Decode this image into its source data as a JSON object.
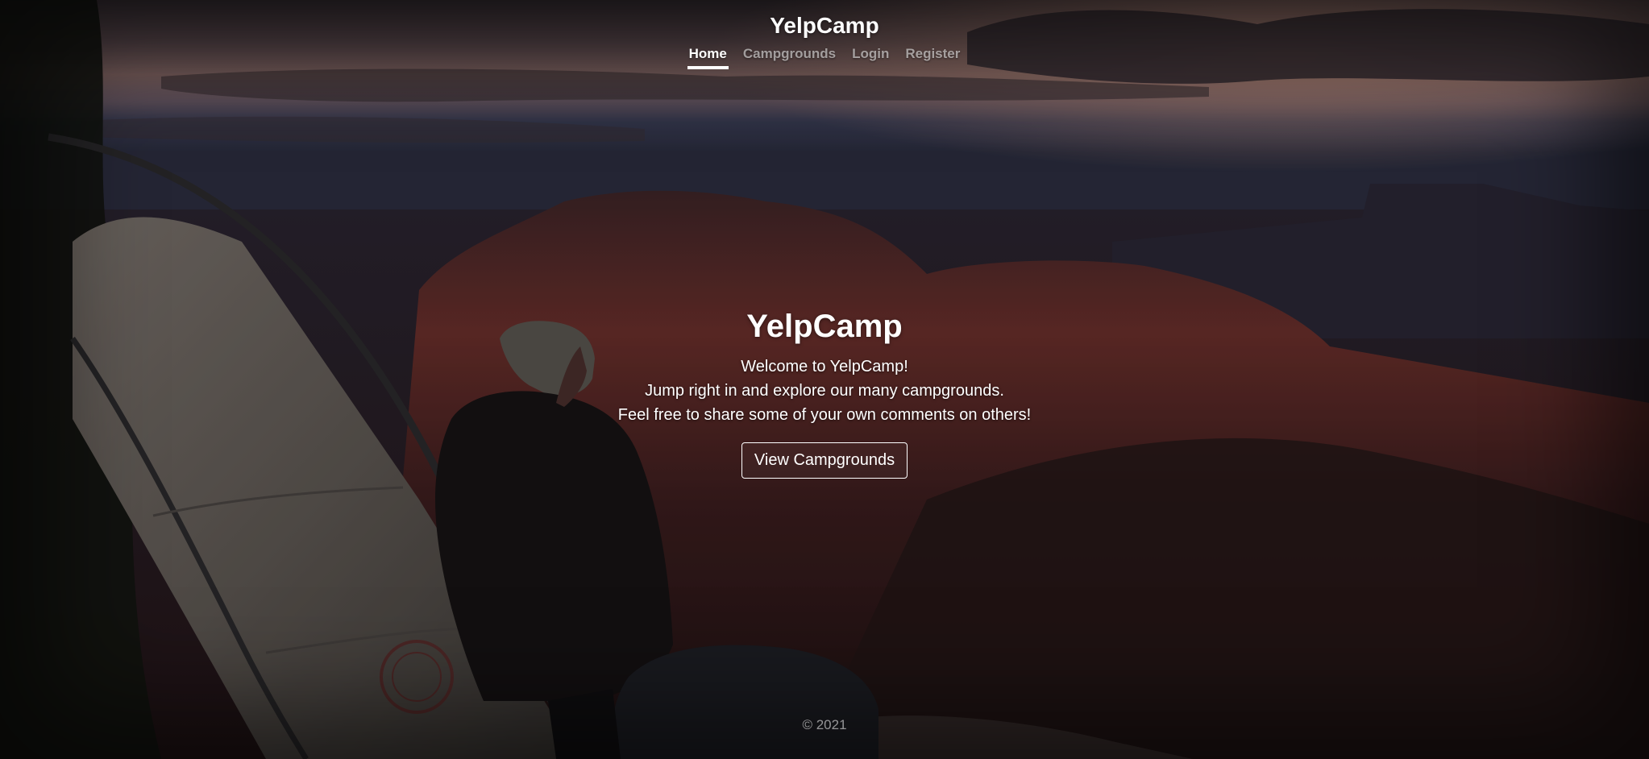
{
  "header": {
    "brand": "YelpCamp",
    "nav": [
      {
        "label": "Home",
        "active": true
      },
      {
        "label": "Campgrounds",
        "active": false
      },
      {
        "label": "Login",
        "active": false
      },
      {
        "label": "Register",
        "active": false
      }
    ]
  },
  "hero": {
    "title": "YelpCamp",
    "lines": [
      "Welcome to YelpCamp!",
      "Jump right in and explore our many campgrounds.",
      "Feel free to share some of your own comments on others!"
    ],
    "button_label": "View Campgrounds"
  },
  "footer": {
    "text": "© 2021"
  },
  "colors": {
    "text": "#ffffff",
    "muted_nav": "#8c8a8a",
    "sky_top": "#3b3238",
    "sky_glow": "#a77f73",
    "mesa": "#4d2523"
  }
}
